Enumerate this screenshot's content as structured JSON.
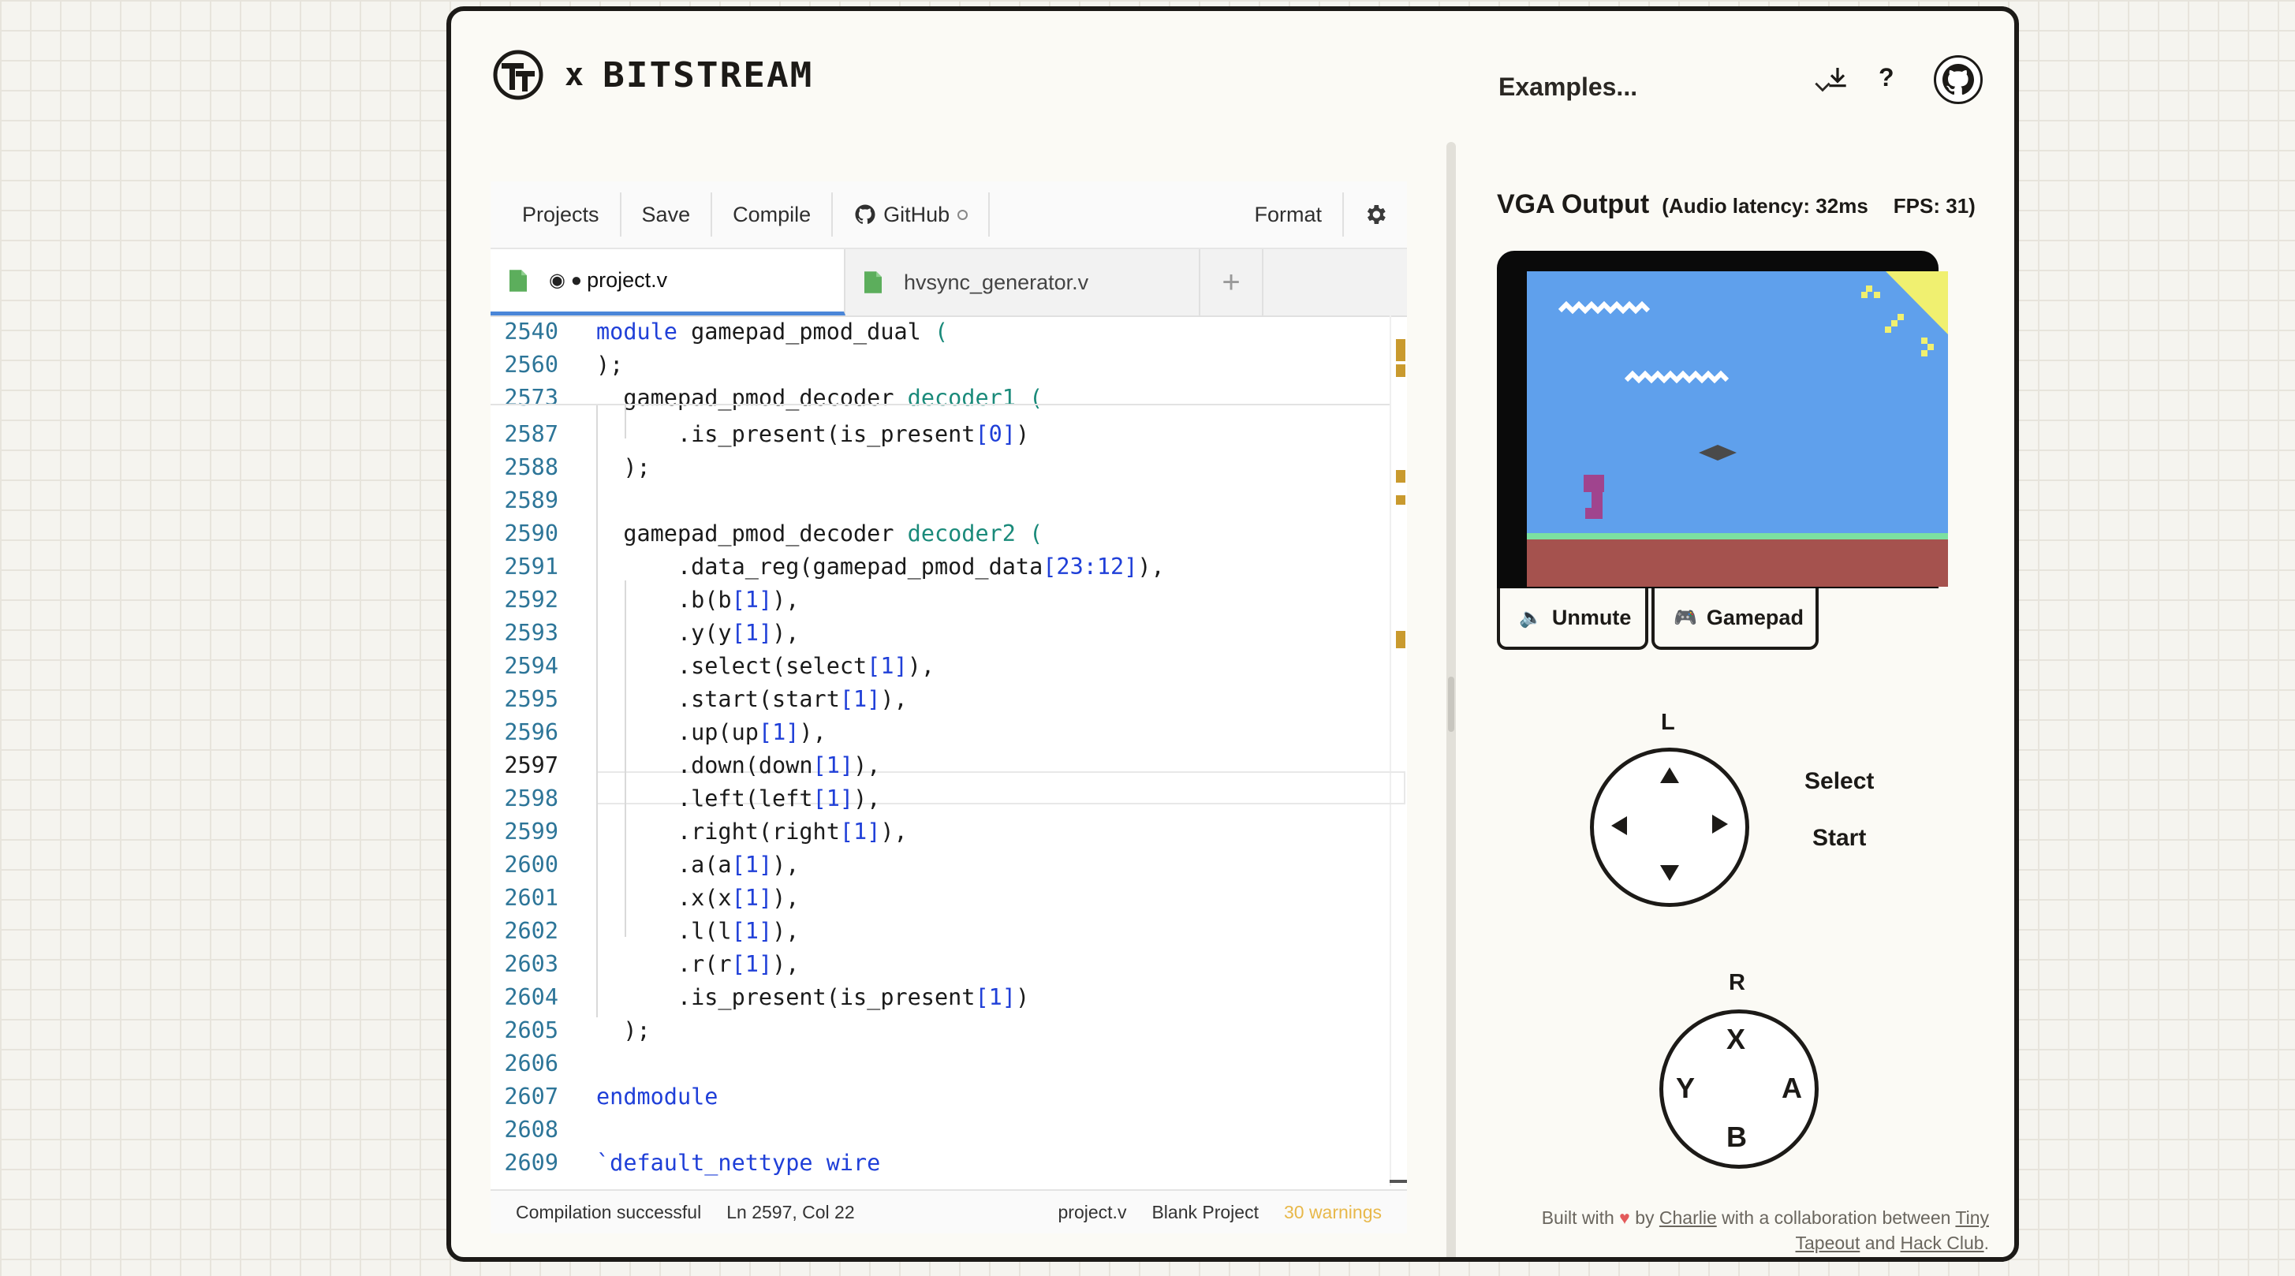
{
  "header": {
    "logo_x": "x",
    "logo_word": "BITSTREAM",
    "examples_label": "Examples...",
    "help_label": "?"
  },
  "toolbar": {
    "projects": "Projects",
    "save": "Save",
    "compile": "Compile",
    "github": "GitHub",
    "format": "Format"
  },
  "tabs": [
    {
      "label": "project.v",
      "modified_marker": "◉ ●",
      "active": true
    },
    {
      "label": "hvsync_generator.v",
      "active": false
    },
    {
      "label": "+"
    }
  ],
  "code_lines": [
    {
      "n": "2540",
      "text": "module gamepad_pmod_dual ("
    },
    {
      "n": "2560",
      "text": ");"
    },
    {
      "n": "2573",
      "text": "  gamepad_pmod_decoder decoder1 ("
    },
    {
      "n": "2587",
      "text": "      .is_present(is_present[0])"
    },
    {
      "n": "2588",
      "text": "  );"
    },
    {
      "n": "2589",
      "text": ""
    },
    {
      "n": "2590",
      "text": "  gamepad_pmod_decoder decoder2 ("
    },
    {
      "n": "2591",
      "text": "      .data_reg(gamepad_pmod_data[23:12]),"
    },
    {
      "n": "2592",
      "text": "      .b(b[1]),"
    },
    {
      "n": "2593",
      "text": "      .y(y[1]),"
    },
    {
      "n": "2594",
      "text": "      .select(select[1]),"
    },
    {
      "n": "2595",
      "text": "      .start(start[1]),"
    },
    {
      "n": "2596",
      "text": "      .up(up[1]),"
    },
    {
      "n": "2597",
      "text": "      .down(down[1]),"
    },
    {
      "n": "2598",
      "text": "      .left(left[1]),"
    },
    {
      "n": "2599",
      "text": "      .right(right[1]),"
    },
    {
      "n": "2600",
      "text": "      .a(a[1]),"
    },
    {
      "n": "2601",
      "text": "      .x(x[1]),"
    },
    {
      "n": "2602",
      "text": "      .l(l[1]),"
    },
    {
      "n": "2603",
      "text": "      .r(r[1]),"
    },
    {
      "n": "2604",
      "text": "      .is_present(is_present[1])"
    },
    {
      "n": "2605",
      "text": "  );"
    },
    {
      "n": "2606",
      "text": ""
    },
    {
      "n": "2607",
      "text": "endmodule"
    },
    {
      "n": "2608",
      "text": ""
    },
    {
      "n": "2609",
      "text": "`default_nettype wire"
    }
  ],
  "status": {
    "compile": "Compilation successful",
    "cursor": "Ln 2597, Col 22",
    "file": "project.v",
    "project": "Blank Project",
    "warnings": "30 warnings"
  },
  "vga": {
    "title": "VGA Output",
    "latency": "(Audio latency: 32ms",
    "fps": "FPS: 31)",
    "unmute": "Unmute",
    "gamepad": "Gamepad"
  },
  "gamepad": {
    "l": "L",
    "r": "R",
    "select": "Select",
    "start": "Start",
    "x": "X",
    "y": "Y",
    "a": "A",
    "b": "B"
  },
  "footer": {
    "built_with": "Built with",
    "by": "by",
    "charlie": "Charlie",
    "collab": "with a collaboration between",
    "tiny_tapeout": "Tiny Tapeout",
    "and": "and",
    "hack_club": "Hack Club",
    "period": "."
  },
  "colors": {
    "accent": "#4a86d8",
    "warning": "#e8b84a",
    "border": "#1c1a17",
    "sky": "#5fa0ec",
    "ground": "#a5524e",
    "grass": "#7ce0a0"
  }
}
